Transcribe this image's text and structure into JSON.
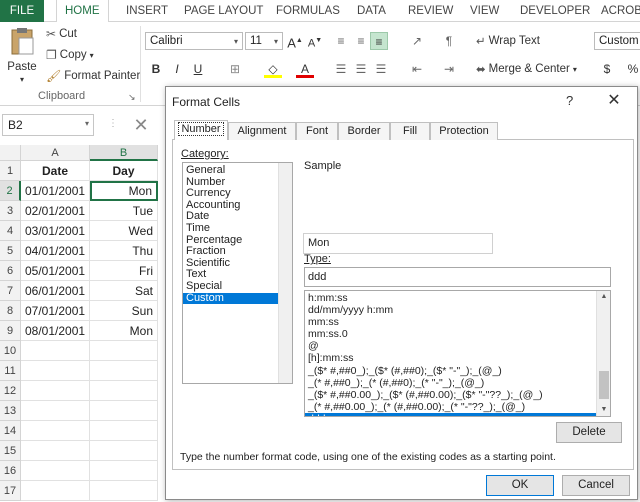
{
  "ribbon_tabs": [
    "FILE",
    "HOME",
    "INSERT",
    "PAGE LAYOUT",
    "FORMULAS",
    "DATA",
    "REVIEW",
    "VIEW",
    "DEVELOPER",
    "ACROBA"
  ],
  "clipboard": {
    "paste": "Paste",
    "cut": "Cut",
    "copy": "Copy",
    "copy_dd": "▾",
    "format_painter": "Format Painter",
    "group_label": "Clipboard",
    "launcher": "↘"
  },
  "font": {
    "name": "Calibri",
    "size": "11",
    "bold": "B",
    "italic": "I",
    "underline": "U",
    "grow": "A",
    "shrink": "A",
    "font_color": "A"
  },
  "alignment": {
    "wrap_text": "Wrap Text",
    "merge_center": "Merge & Center",
    "merge_dd": "▾"
  },
  "number": {
    "format": "Custom",
    "currency": "$",
    "percent": "%"
  },
  "namebox": {
    "value": "B2",
    "dropdown": "▾"
  },
  "formula_bar": {
    "cancel": "✕",
    "separator": "⋮"
  },
  "grid": {
    "corner": "",
    "columns": [
      "A",
      "B"
    ],
    "rows": [
      {
        "num": "1",
        "a": "Date",
        "b": "Day"
      },
      {
        "num": "2",
        "a": "01/01/2001",
        "b": "Mon"
      },
      {
        "num": "3",
        "a": "02/01/2001",
        "b": "Tue"
      },
      {
        "num": "4",
        "a": "03/01/2001",
        "b": "Wed"
      },
      {
        "num": "5",
        "a": "04/01/2001",
        "b": "Thu"
      },
      {
        "num": "6",
        "a": "05/01/2001",
        "b": "Fri"
      },
      {
        "num": "7",
        "a": "06/01/2001",
        "b": "Sat"
      },
      {
        "num": "8",
        "a": "07/01/2001",
        "b": "Sun"
      },
      {
        "num": "9",
        "a": "08/01/2001",
        "b": "Mon"
      },
      {
        "num": "10",
        "a": "",
        "b": ""
      },
      {
        "num": "11",
        "a": "",
        "b": ""
      },
      {
        "num": "12",
        "a": "",
        "b": ""
      },
      {
        "num": "13",
        "a": "",
        "b": ""
      },
      {
        "num": "14",
        "a": "",
        "b": ""
      },
      {
        "num": "15",
        "a": "",
        "b": ""
      },
      {
        "num": "16",
        "a": "",
        "b": ""
      },
      {
        "num": "17",
        "a": "",
        "b": ""
      }
    ]
  },
  "dialog": {
    "title": "Format Cells",
    "help": "?",
    "close": "✕",
    "tabs": [
      "Number",
      "Alignment",
      "Font",
      "Border",
      "Fill",
      "Protection"
    ],
    "category_label": "Category:",
    "categories": [
      "General",
      "Number",
      "Currency",
      "Accounting",
      "Date",
      "Time",
      "Percentage",
      "Fraction",
      "Scientific",
      "Text",
      "Special",
      "Custom"
    ],
    "selected_category": "Custom",
    "sample_label": "Sample",
    "sample_value": "Mon",
    "type_label": "Type:",
    "type_value": "ddd",
    "formats": [
      "h:mm:ss",
      "dd/mm/yyyy h:mm",
      "mm:ss",
      "mm:ss.0",
      "@",
      "[h]:mm:ss",
      "_($* #,##0_);_($* (#,##0);_($* \"-\"_);_(@_)",
      "_(* #,##0_);_(* (#,##0);_(* \"-\"_);_(@_)",
      "_($* #,##0.00_);_($* (#,##0.00);_($* \"-\"??_);_(@_)",
      "_(* #,##0.00_);_(* (#,##0.00);_(* \"-\"??_);_(@_)",
      "ddd"
    ],
    "selected_format": "ddd",
    "scroll_up": "▲",
    "scroll_down": "▼",
    "delete": "Delete",
    "hint": "Type the number format code, using one of the existing codes as a starting point.",
    "ok": "OK",
    "cancel": "Cancel"
  },
  "colors": {
    "excel_green": "#217346",
    "selection_blue": "#0078d7"
  }
}
